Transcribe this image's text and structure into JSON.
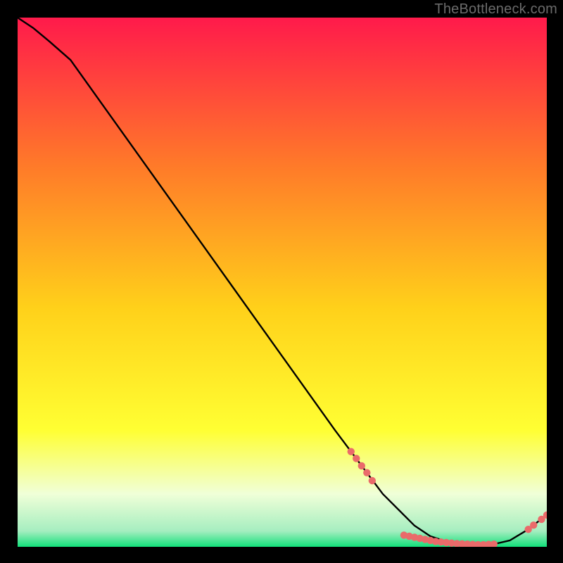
{
  "watermark": "TheBottleneck.com",
  "colors": {
    "gradient_top": "#ff1a4b",
    "gradient_mid1": "#ff7a29",
    "gradient_mid2": "#ffd11a",
    "gradient_mid3": "#ffff33",
    "gradient_bottom_pale": "#e8ffcc",
    "gradient_bottom": "#11e07a",
    "line": "#000000",
    "marker": "#ea6a6a",
    "frame": "#000000"
  },
  "chart_data": {
    "type": "line",
    "title": "",
    "xlabel": "",
    "ylabel": "",
    "xlim": [
      0,
      100
    ],
    "ylim": [
      0,
      100
    ],
    "series": [
      {
        "name": "curve",
        "x": [
          0,
          3,
          6,
          10,
          15,
          20,
          25,
          30,
          35,
          40,
          45,
          50,
          55,
          60,
          63,
          66,
          69,
          72,
          75,
          78,
          81,
          84,
          87,
          90,
          93,
          96,
          98,
          100
        ],
        "y": [
          100,
          98,
          95.5,
          92,
          85,
          78,
          71,
          64,
          57,
          50,
          43,
          36,
          29,
          22,
          18,
          14,
          10,
          7,
          4,
          2,
          1,
          0.5,
          0.3,
          0.5,
          1.2,
          3.0,
          4.5,
          6.0
        ]
      }
    ],
    "markers": [
      {
        "x": 63,
        "y": 18
      },
      {
        "x": 64,
        "y": 16.7
      },
      {
        "x": 65,
        "y": 15.3
      },
      {
        "x": 66,
        "y": 14
      },
      {
        "x": 67,
        "y": 12.5
      },
      {
        "x": 73,
        "y": 2.2
      },
      {
        "x": 74,
        "y": 2.0
      },
      {
        "x": 75,
        "y": 1.8
      },
      {
        "x": 76,
        "y": 1.6
      },
      {
        "x": 77,
        "y": 1.4
      },
      {
        "x": 78,
        "y": 1.2
      },
      {
        "x": 79,
        "y": 1.0
      },
      {
        "x": 80,
        "y": 0.9
      },
      {
        "x": 81,
        "y": 0.8
      },
      {
        "x": 82,
        "y": 0.7
      },
      {
        "x": 83,
        "y": 0.6
      },
      {
        "x": 84,
        "y": 0.55
      },
      {
        "x": 85,
        "y": 0.5
      },
      {
        "x": 86,
        "y": 0.45
      },
      {
        "x": 87,
        "y": 0.4
      },
      {
        "x": 88,
        "y": 0.4
      },
      {
        "x": 89,
        "y": 0.45
      },
      {
        "x": 90,
        "y": 0.5
      },
      {
        "x": 96.5,
        "y": 3.3
      },
      {
        "x": 97.5,
        "y": 4.1
      },
      {
        "x": 99.0,
        "y": 5.2
      },
      {
        "x": 100.0,
        "y": 6.0
      }
    ]
  }
}
